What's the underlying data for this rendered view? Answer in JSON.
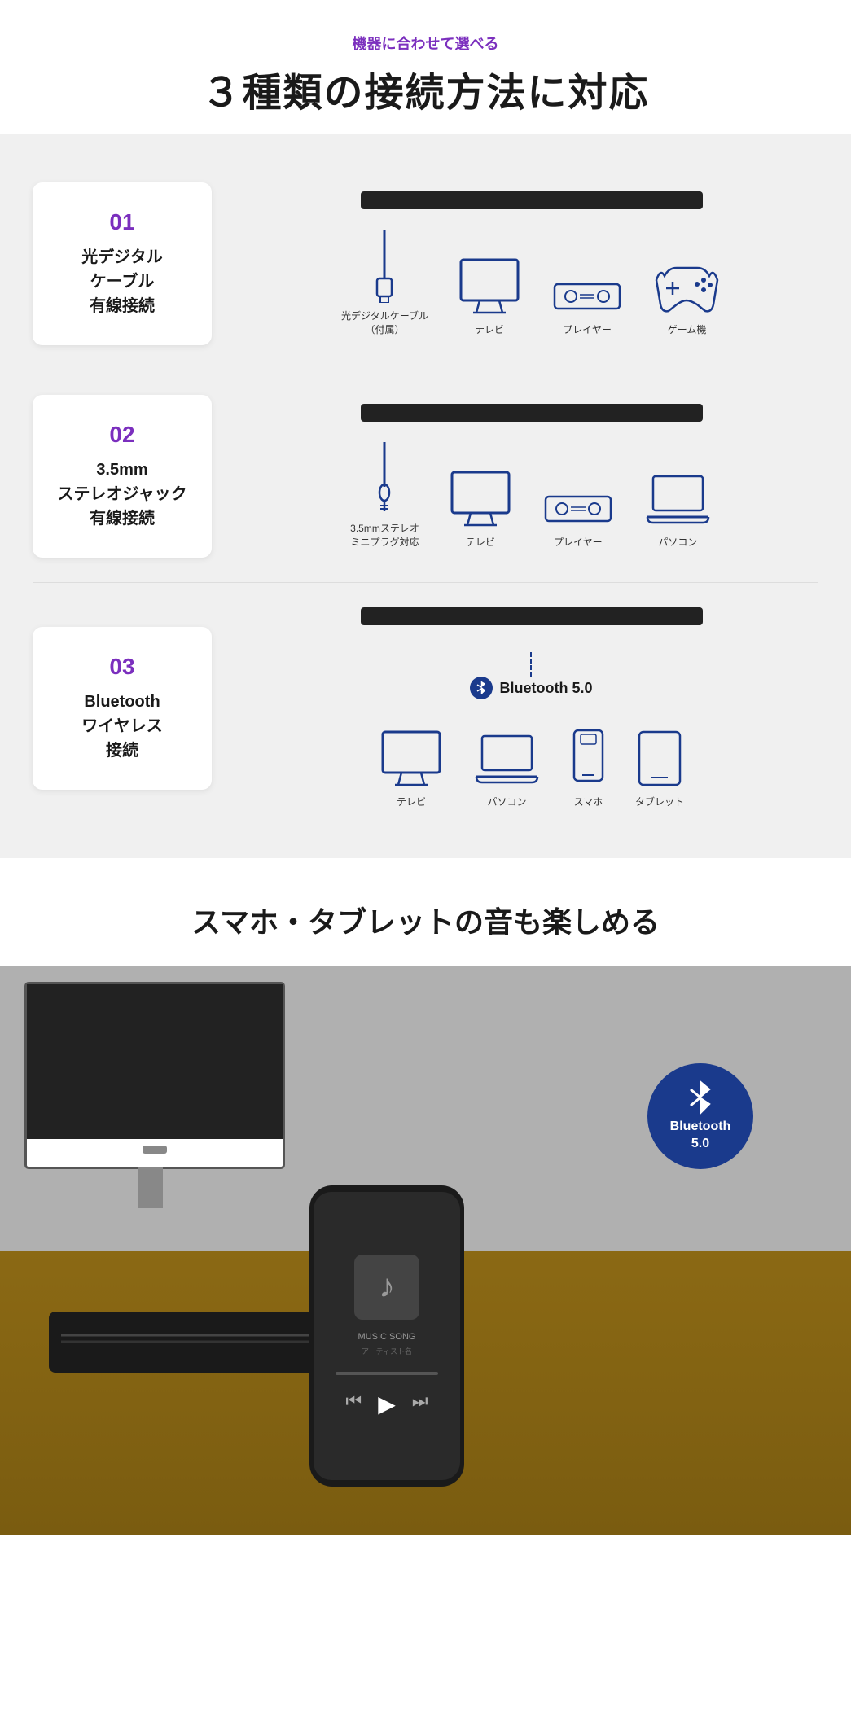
{
  "header": {
    "subtitle": "機器に合わせて選べる",
    "title": "３種類の接続方法に対応"
  },
  "connections": [
    {
      "number": "01",
      "title": "光デジタル\nケーブル\n有線接続",
      "devices": [
        {
          "label": "光デジタルケーブル\n（付属）",
          "type": "cable-optical"
        },
        {
          "label": "テレビ",
          "type": "tv"
        },
        {
          "label": "プレイヤー",
          "type": "player"
        },
        {
          "label": "ゲーム機",
          "type": "gamepad"
        }
      ]
    },
    {
      "number": "02",
      "title": "3.5mm\nステレオジャック\n有線接続",
      "devices": [
        {
          "label": "3.5mmステレオ\nミニプラグ対応",
          "type": "cable-35mm"
        },
        {
          "label": "テレビ",
          "type": "tv"
        },
        {
          "label": "プレイヤー",
          "type": "player"
        },
        {
          "label": "パソコン",
          "type": "laptop"
        }
      ]
    },
    {
      "number": "03",
      "title": "Bluetooth\nワイヤレス\n接続",
      "bluetooth_label": "Bluetooth 5.0",
      "devices": [
        {
          "label": "テレビ",
          "type": "tv"
        },
        {
          "label": "パソコン",
          "type": "laptop"
        },
        {
          "label": "スマホ",
          "type": "smartphone"
        },
        {
          "label": "タブレット",
          "type": "tablet"
        }
      ]
    }
  ],
  "promo": {
    "title": "スマホ・タブレットの音も楽しめる",
    "bluetooth_badge": {
      "line1": "Bluetooth",
      "line2": "5.0"
    }
  }
}
